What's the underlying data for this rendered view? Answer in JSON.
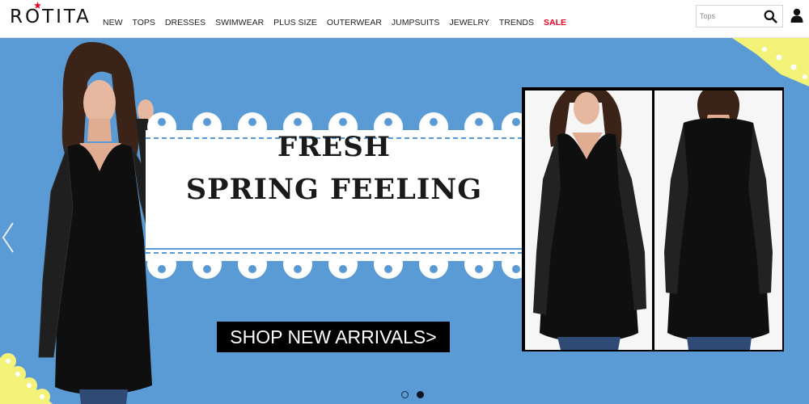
{
  "brand": {
    "logo_text": "ROTITA",
    "star_color": "#e8001c"
  },
  "nav": {
    "items": [
      {
        "label": "NEW"
      },
      {
        "label": "TOPS"
      },
      {
        "label": "DRESSES"
      },
      {
        "label": "SWIMWEAR"
      },
      {
        "label": "PLUS SIZE"
      },
      {
        "label": "OUTERWEAR"
      },
      {
        "label": "JUMPSUITS"
      },
      {
        "label": "JEWELRY"
      },
      {
        "label": "TRENDS"
      },
      {
        "label": "SALE"
      }
    ]
  },
  "search": {
    "placeholder": "Tops",
    "value": ""
  },
  "icons": {
    "search": "search-icon",
    "user": "user-icon",
    "prev": "chevron-left-icon"
  },
  "banner": {
    "headline_line1": "FRESH",
    "headline_line2": "SPRING FEELING",
    "cta_label": "SHOP NEW ARRIVALS>",
    "slides_total": 2,
    "active_slide": 2,
    "background_color": "#5b9bd5",
    "lace_color": "#f3f37a"
  }
}
